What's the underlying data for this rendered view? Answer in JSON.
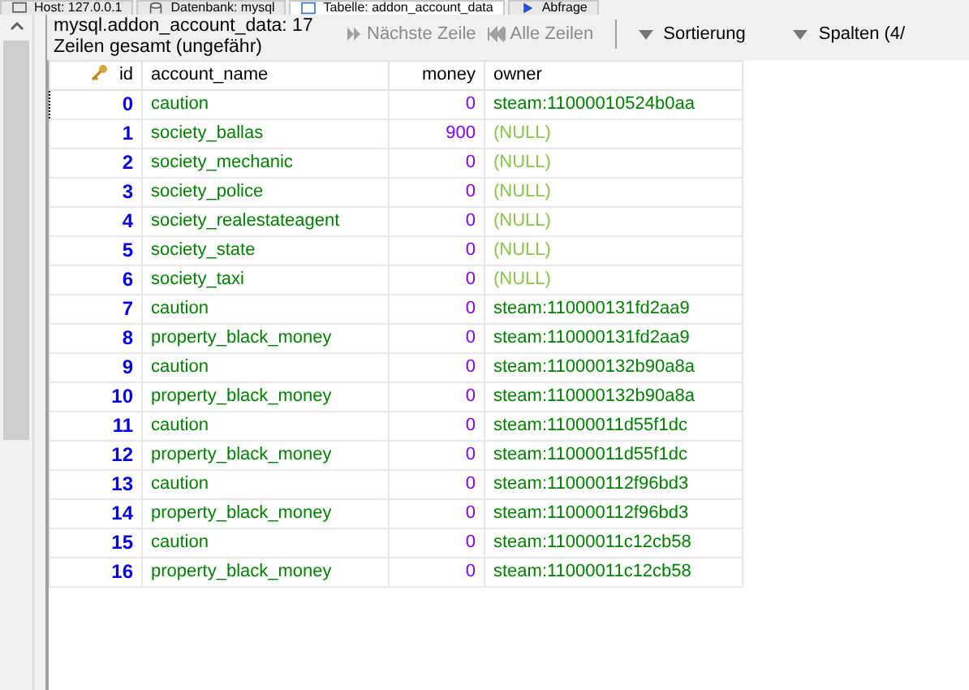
{
  "tabs": [
    {
      "label": "Host: 127.0.0.1",
      "kind": "host",
      "selected": false
    },
    {
      "label": "Datenbank: mysql",
      "kind": "database",
      "selected": false
    },
    {
      "label": "Tabelle: addon_account_data",
      "kind": "table",
      "selected": true
    },
    {
      "label": "Abfrage",
      "kind": "query",
      "selected": false
    }
  ],
  "header": {
    "title": "mysql.addon_account_data: 17",
    "subtitle": "Zeilen gesamt (ungefähr)",
    "next_rows": "Nächste Zeile",
    "all_rows": "Alle Zeilen",
    "sort": "Sortierung",
    "columns": "Spalten (4/"
  },
  "table": {
    "columns": [
      {
        "label": "id",
        "key": true
      },
      {
        "label": "account_name",
        "key": false
      },
      {
        "label": "money",
        "key": false
      },
      {
        "label": "owner",
        "key": false
      }
    ],
    "rows": [
      {
        "id": "0",
        "account_name": "caution",
        "money": "0",
        "owner": "steam:11000010524b0aa",
        "owner_null": false,
        "focused": true
      },
      {
        "id": "1",
        "account_name": "society_ballas",
        "money": "900",
        "owner": "(NULL)",
        "owner_null": true,
        "focused": false
      },
      {
        "id": "2",
        "account_name": "society_mechanic",
        "money": "0",
        "owner": "(NULL)",
        "owner_null": true,
        "focused": false
      },
      {
        "id": "3",
        "account_name": "society_police",
        "money": "0",
        "owner": "(NULL)",
        "owner_null": true,
        "focused": false
      },
      {
        "id": "4",
        "account_name": "society_realestateagent",
        "money": "0",
        "owner": "(NULL)",
        "owner_null": true,
        "focused": false
      },
      {
        "id": "5",
        "account_name": "society_state",
        "money": "0",
        "owner": "(NULL)",
        "owner_null": true,
        "focused": false
      },
      {
        "id": "6",
        "account_name": "society_taxi",
        "money": "0",
        "owner": "(NULL)",
        "owner_null": true,
        "focused": false
      },
      {
        "id": "7",
        "account_name": "caution",
        "money": "0",
        "owner": "steam:110000131fd2aa9",
        "owner_null": false,
        "focused": false
      },
      {
        "id": "8",
        "account_name": "property_black_money",
        "money": "0",
        "owner": "steam:110000131fd2aa9",
        "owner_null": false,
        "focused": false
      },
      {
        "id": "9",
        "account_name": "caution",
        "money": "0",
        "owner": "steam:110000132b90a8a",
        "owner_null": false,
        "focused": false
      },
      {
        "id": "10",
        "account_name": "property_black_money",
        "money": "0",
        "owner": "steam:110000132b90a8a",
        "owner_null": false,
        "focused": false
      },
      {
        "id": "11",
        "account_name": "caution",
        "money": "0",
        "owner": "steam:11000011d55f1dc",
        "owner_null": false,
        "focused": false
      },
      {
        "id": "12",
        "account_name": "property_black_money",
        "money": "0",
        "owner": "steam:11000011d55f1dc",
        "owner_null": false,
        "focused": false
      },
      {
        "id": "13",
        "account_name": "caution",
        "money": "0",
        "owner": "steam:110000112f96bd3",
        "owner_null": false,
        "focused": false
      },
      {
        "id": "14",
        "account_name": "property_black_money",
        "money": "0",
        "owner": "steam:110000112f96bd3",
        "owner_null": false,
        "focused": false
      },
      {
        "id": "15",
        "account_name": "caution",
        "money": "0",
        "owner": "steam:11000011c12cb58",
        "owner_null": false,
        "focused": false
      },
      {
        "id": "16",
        "account_name": "property_black_money",
        "money": "0",
        "owner": "steam:11000011c12cb58",
        "owner_null": false,
        "focused": false
      }
    ]
  }
}
